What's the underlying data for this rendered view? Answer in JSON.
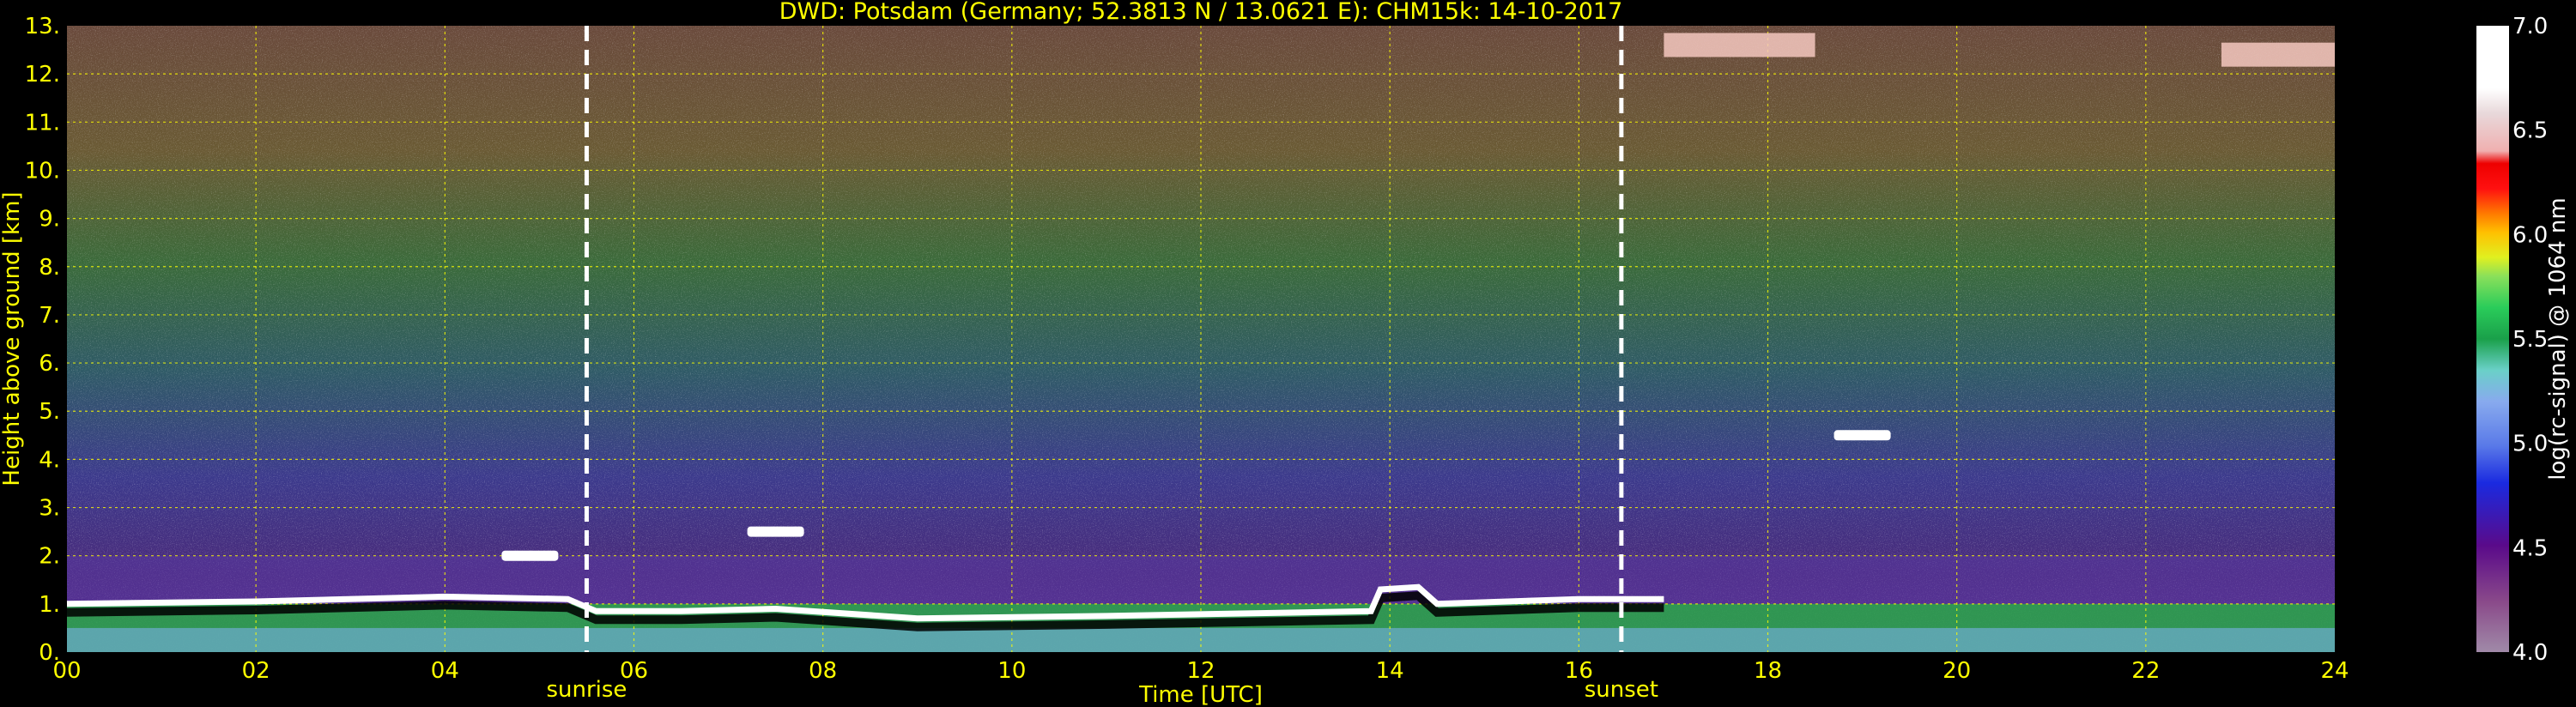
{
  "chart_data": {
    "type": "heatmap",
    "title": "DWD: Potsdam (Germany; 52.3813 N / 13.0621 E):    CHM15k: 14-10-2017",
    "xlabel": "Time [UTC]",
    "ylabel": "Height above ground [km]",
    "xlim": [
      0,
      24
    ],
    "ylim": [
      0,
      13
    ],
    "x_ticks": [
      "00",
      "02",
      "04",
      "06",
      "08",
      "10",
      "12",
      "14",
      "16",
      "18",
      "20",
      "22",
      "24"
    ],
    "y_ticks": [
      "0.",
      "1.",
      "2.",
      "3.",
      "4.",
      "5.",
      "6.",
      "7.",
      "8.",
      "9.",
      "10.",
      "11.",
      "12.",
      "13."
    ],
    "grid": true,
    "markers": [
      {
        "label": "sunrise",
        "time": 5.5
      },
      {
        "label": "sunset",
        "time": 16.45
      }
    ],
    "colorbar": {
      "label": "log(rc-signal) @ 1064 nm",
      "range": [
        4.0,
        7.0
      ],
      "ticks": [
        "4.0",
        "4.5",
        "5.0",
        "5.5",
        "6.0",
        "6.5",
        "7.0"
      ]
    },
    "cloud_base_height_km": [
      {
        "time": 0.0,
        "height": 1.0
      },
      {
        "time": 2.0,
        "height": 1.05
      },
      {
        "time": 4.0,
        "height": 1.15
      },
      {
        "time": 5.3,
        "height": 1.1
      },
      {
        "time": 5.6,
        "height": 0.85
      },
      {
        "time": 6.5,
        "height": 0.85
      },
      {
        "time": 7.5,
        "height": 0.9
      },
      {
        "time": 9.0,
        "height": 0.7
      },
      {
        "time": 11.0,
        "height": 0.75
      },
      {
        "time": 13.8,
        "height": 0.85
      },
      {
        "time": 13.9,
        "height": 1.3
      },
      {
        "time": 14.3,
        "height": 1.35
      },
      {
        "time": 14.5,
        "height": 1.0
      },
      {
        "time": 16.0,
        "height": 1.1
      },
      {
        "time": 16.9,
        "height": 1.1
      }
    ],
    "elevated_layers_km": [
      {
        "t0": 7.2,
        "t1": 7.8,
        "height": 2.5
      },
      {
        "t0": 18.7,
        "t1": 19.3,
        "height": 4.5
      },
      {
        "t0": 4.6,
        "t1": 5.2,
        "height": 2.0
      }
    ],
    "high_clouds_km": [
      {
        "t0": 16.9,
        "t1": 18.5,
        "height": 12.6
      },
      {
        "t0": 22.8,
        "t1": 24.0,
        "height": 12.4
      }
    ]
  }
}
